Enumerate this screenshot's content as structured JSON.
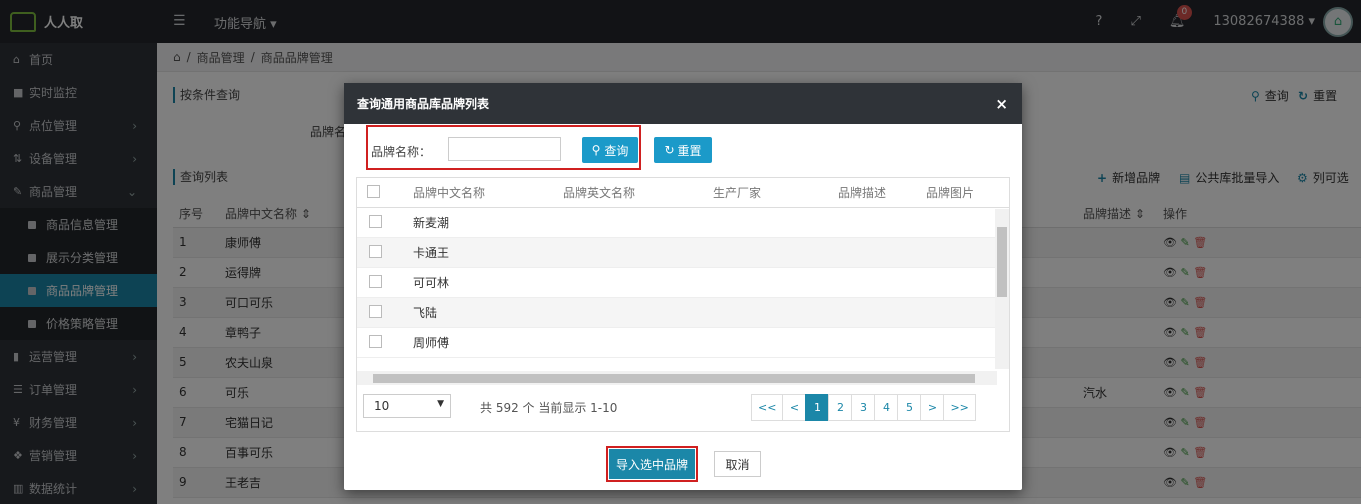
{
  "app": {
    "title": "人人取"
  },
  "topbar": {
    "func_nav": "功能导航 ▾",
    "help": "?",
    "expand": "⤢",
    "notify_count": "0",
    "user": "13082674388 ▾"
  },
  "sidebar": {
    "items": [
      {
        "label": "首页",
        "icon": "home-icon",
        "glyph": "⌂"
      },
      {
        "label": "实时监控",
        "icon": "video-icon",
        "glyph": "■"
      },
      {
        "label": "点位管理",
        "icon": "location-icon",
        "glyph": "⚲",
        "arrow": "›"
      },
      {
        "label": "设备管理",
        "icon": "sort-icon",
        "glyph": "⇅",
        "arrow": "›"
      },
      {
        "label": "商品管理",
        "icon": "edit-icon",
        "glyph": "✎",
        "arrow": "⌄"
      }
    ],
    "subitems": [
      {
        "label": "商品信息管理"
      },
      {
        "label": "展示分类管理"
      },
      {
        "label": "商品品牌管理",
        "active": true
      },
      {
        "label": "价格策略管理"
      }
    ],
    "items2": [
      {
        "label": "运营管理",
        "icon": "bookmark-icon",
        "glyph": "▮",
        "arrow": "›"
      },
      {
        "label": "订单管理",
        "icon": "list-icon",
        "glyph": "☰",
        "arrow": "›"
      },
      {
        "label": "财务管理",
        "icon": "yen-icon",
        "glyph": "¥",
        "arrow": "›"
      },
      {
        "label": "营销管理",
        "icon": "gift-icon",
        "glyph": "❖",
        "arrow": "›"
      },
      {
        "label": "数据统计",
        "icon": "chart-icon",
        "glyph": "▥",
        "arrow": "›"
      }
    ]
  },
  "breadcrumb": {
    "home": "⌂",
    "sep1": "/",
    "level1": "商品管理",
    "sep2": "/",
    "level2": "商品品牌管理"
  },
  "query_section": {
    "title": "按条件查询",
    "search": "查询",
    "reset": "重置",
    "field_label": "品牌名"
  },
  "list_section": {
    "title": "查询列表",
    "add": "新增品牌",
    "import": "公共库批量导入",
    "columns_opt": "列可选"
  },
  "bg_table": {
    "headers": [
      "序号",
      "品牌中文名称 ⇕",
      "品牌描述 ⇕",
      "操作"
    ],
    "rows": [
      {
        "no": "1",
        "name": "康师傅",
        "desc": ""
      },
      {
        "no": "2",
        "name": "运得牌",
        "desc": ""
      },
      {
        "no": "3",
        "name": "可口可乐",
        "desc": ""
      },
      {
        "no": "4",
        "name": "章鸭子",
        "desc": ""
      },
      {
        "no": "5",
        "name": "农夫山泉",
        "desc": ""
      },
      {
        "no": "6",
        "name": "可乐",
        "desc": "汽水"
      },
      {
        "no": "7",
        "name": "宅猫日记",
        "desc": ""
      },
      {
        "no": "8",
        "name": "百事可乐",
        "desc": ""
      },
      {
        "no": "9",
        "name": "王老吉",
        "desc": ""
      }
    ]
  },
  "modal": {
    "title": "查询通用商品库品牌列表",
    "close": "×",
    "field_label": "品牌名称：",
    "field_value": "",
    "search": "查询",
    "reset": "重置",
    "headers": [
      "品牌中文名称",
      "品牌英文名称",
      "生产厂家",
      "品牌描述",
      "品牌图片"
    ],
    "rows": [
      {
        "name": "新麦潮"
      },
      {
        "name": "卡通王"
      },
      {
        "name": "可可林"
      },
      {
        "name": "飞陆"
      },
      {
        "name": "周师傅"
      }
    ],
    "page_size": "10",
    "page_info": "共 592 个 当前显示 1-10",
    "pager": [
      "<<",
      "<",
      "1",
      "2",
      "3",
      "4",
      "5",
      ">",
      ">>"
    ],
    "active_page": "1",
    "import_btn": "导入选中品牌",
    "cancel_btn": "取消"
  },
  "colors": {
    "accent": "#1b87a8",
    "button": "#1b9ac9",
    "highlight": "#d02020",
    "sidebar": "#2f3338"
  }
}
